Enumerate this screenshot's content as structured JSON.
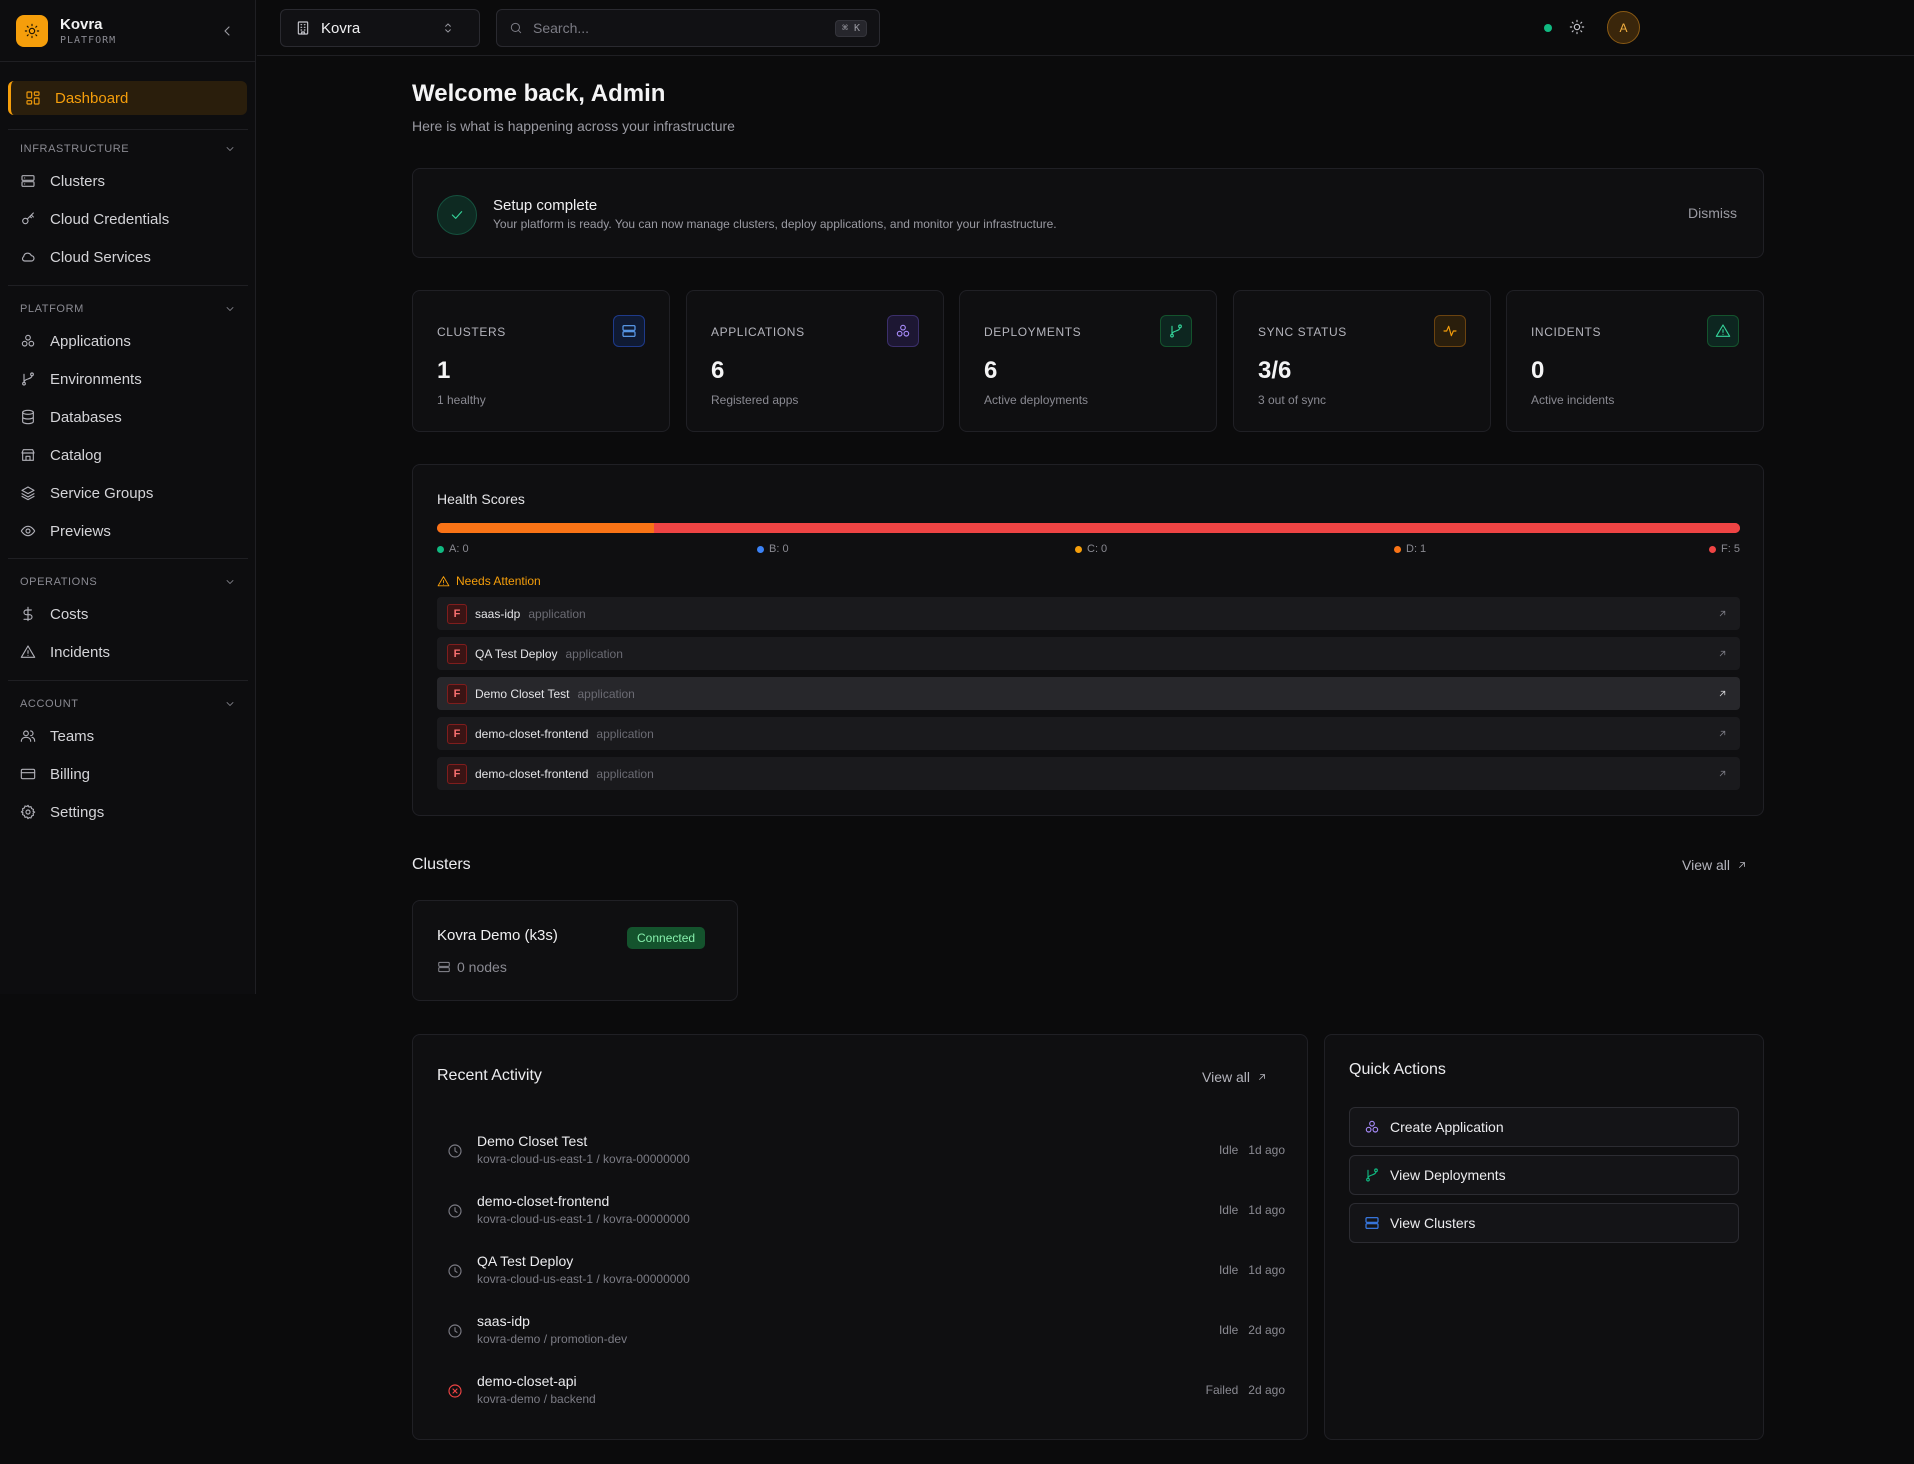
{
  "brand": {
    "name": "Kovra",
    "subtitle": "PLATFORM"
  },
  "sidebar": {
    "active": {
      "label": "Dashboard",
      "icon": "dashboard-icon"
    },
    "sections": [
      {
        "title": "INFRASTRUCTURE",
        "items": [
          {
            "label": "Clusters",
            "icon": "server-icon"
          },
          {
            "label": "Cloud Credentials",
            "icon": "key-icon"
          },
          {
            "label": "Cloud Services",
            "icon": "cloud-icon"
          }
        ]
      },
      {
        "title": "PLATFORM",
        "items": [
          {
            "label": "Applications",
            "icon": "boxes-icon"
          },
          {
            "label": "Environments",
            "icon": "git-branch-icon"
          },
          {
            "label": "Databases",
            "icon": "database-icon"
          },
          {
            "label": "Catalog",
            "icon": "store-icon"
          },
          {
            "label": "Service Groups",
            "icon": "layers-icon"
          },
          {
            "label": "Previews",
            "icon": "eye-icon"
          }
        ]
      },
      {
        "title": "OPERATIONS",
        "items": [
          {
            "label": "Costs",
            "icon": "dollar-icon"
          },
          {
            "label": "Incidents",
            "icon": "alert-triangle-icon"
          }
        ]
      },
      {
        "title": "ACCOUNT",
        "items": [
          {
            "label": "Teams",
            "icon": "users-icon"
          },
          {
            "label": "Billing",
            "icon": "credit-card-icon"
          },
          {
            "label": "Settings",
            "icon": "gear-icon"
          }
        ]
      }
    ]
  },
  "topbar": {
    "org": "Kovra",
    "search_placeholder": "Search...",
    "search_shortcut": "⌘ K",
    "avatar_initial": "A",
    "status_color": "#10b981"
  },
  "header": {
    "title": "Welcome back, Admin",
    "subtitle": "Here is what is happening across your infrastructure"
  },
  "setup": {
    "title": "Setup complete",
    "description": "Your platform is ready. You can now manage clusters, deploy applications, and monitor your infrastructure.",
    "dismiss": "Dismiss"
  },
  "stats": [
    {
      "label": "CLUSTERS",
      "value": "1",
      "sub": "1 healthy",
      "icon": "server-icon",
      "color": "#3b82f6"
    },
    {
      "label": "APPLICATIONS",
      "value": "6",
      "sub": "Registered apps",
      "icon": "boxes-icon",
      "color": "#a78bfa"
    },
    {
      "label": "DEPLOYMENTS",
      "value": "6",
      "sub": "Active deployments",
      "icon": "git-branch-icon",
      "color": "#10b981"
    },
    {
      "label": "SYNC STATUS",
      "value": "3/6",
      "sub": "3 out of sync",
      "icon": "activity-icon",
      "color": "#f59e0b"
    },
    {
      "label": "INCIDENTS",
      "value": "0",
      "sub": "Active incidents",
      "icon": "alert-triangle-icon",
      "color": "#10b981"
    }
  ],
  "health": {
    "title": "Health Scores",
    "distribution": [
      {
        "grade": "A",
        "label": "A: 0",
        "count": 0,
        "color": "#10b981"
      },
      {
        "grade": "B",
        "label": "B: 0",
        "count": 0,
        "color": "#3b82f6"
      },
      {
        "grade": "C",
        "label": "C: 0",
        "count": 0,
        "color": "#f59e0b"
      },
      {
        "grade": "D",
        "label": "D: 1",
        "count": 1,
        "color": "#f97316"
      },
      {
        "grade": "F",
        "label": "F: 5",
        "count": 5,
        "color": "#ef4444"
      }
    ],
    "needs_attention_title": "Needs Attention",
    "needs_attention": [
      {
        "grade": "F",
        "name": "saas-idp",
        "type": "application"
      },
      {
        "grade": "F",
        "name": "QA Test Deploy",
        "type": "application"
      },
      {
        "grade": "F",
        "name": "Demo Closet Test",
        "type": "application",
        "highlighted": true
      },
      {
        "grade": "F",
        "name": "demo-closet-frontend",
        "type": "application"
      },
      {
        "grade": "F",
        "name": "demo-closet-frontend",
        "type": "application"
      }
    ]
  },
  "clusters": {
    "title": "Clusters",
    "view_all": "View all",
    "items": [
      {
        "name": "Kovra Demo (k3s)",
        "status": "Connected",
        "nodes": "0 nodes"
      }
    ]
  },
  "recent": {
    "title": "Recent Activity",
    "view_all": "View all",
    "items": [
      {
        "name": "Demo Closet Test",
        "path": "kovra-cloud-us-east-1 / kovra-00000000",
        "status": "Idle",
        "time": "1d ago",
        "icon": "clock-icon"
      },
      {
        "name": "demo-closet-frontend",
        "path": "kovra-cloud-us-east-1 / kovra-00000000",
        "status": "Idle",
        "time": "1d ago",
        "icon": "clock-icon"
      },
      {
        "name": "QA Test Deploy",
        "path": "kovra-cloud-us-east-1 / kovra-00000000",
        "status": "Idle",
        "time": "1d ago",
        "icon": "clock-icon"
      },
      {
        "name": "saas-idp",
        "path": "kovra-demo / promotion-dev",
        "status": "Idle",
        "time": "2d ago",
        "icon": "clock-icon"
      },
      {
        "name": "demo-closet-api",
        "path": "kovra-demo / backend",
        "status": "Failed",
        "time": "2d ago",
        "icon": "x-circle-icon"
      }
    ]
  },
  "quick_actions": {
    "title": "Quick Actions",
    "items": [
      {
        "label": "Create Application",
        "icon": "boxes-icon",
        "color": "#a78bfa"
      },
      {
        "label": "View Deployments",
        "icon": "git-branch-icon",
        "color": "#10b981"
      },
      {
        "label": "View Clusters",
        "icon": "server-icon",
        "color": "#3b82f6"
      }
    ]
  }
}
